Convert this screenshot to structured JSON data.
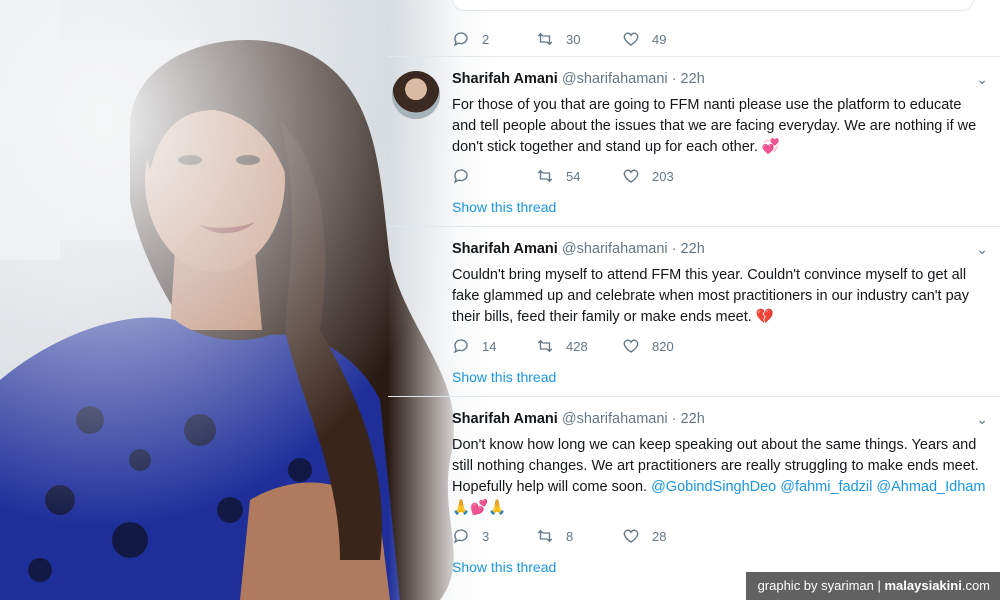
{
  "watermark": {
    "prefix": "graphic by syariman | ",
    "brand": "malaysiakini",
    "suffix": ".com"
  },
  "top_actions": {
    "replies": "2",
    "retweets": "30",
    "likes": "49"
  },
  "tweets": [
    {
      "name": "Sharifah Amani",
      "handle": "@sharifahamani",
      "time": "· 22h",
      "text": "For those of you that are going to FFM nanti please use the platform to educate and tell people about the issues that we are facing everyday. We are nothing if we don't stick together and stand up for each other.",
      "emoji": "💞",
      "replies": "",
      "retweets": "54",
      "likes": "203",
      "show_thread": "Show this thread"
    },
    {
      "name": "Sharifah Amani",
      "handle": "@sharifahamani",
      "time": "· 22h",
      "text": "Couldn't bring myself to attend FFM this year. Couldn't convince myself to get all fake glammed up and celebrate when most practitioners in our industry can't pay their bills, feed their family or make ends meet.",
      "emoji": "💔",
      "replies": "14",
      "retweets": "428",
      "likes": "820",
      "show_thread": "Show this thread"
    },
    {
      "name": "Sharifah Amani",
      "handle": "@sharifahamani",
      "time": "· 22h",
      "text": "Don't know how long we can keep speaking out about the same things. Years and still nothing changes. We art practitioners are really struggling to make ends meet. Hopefully help will come soon.",
      "mentions": "@GobindSinghDeo @fahmi_fadzil @Ahmad_Idham",
      "emoji": "🙏💕🙏",
      "replies": "3",
      "retweets": "8",
      "likes": "28",
      "show_thread": "Show this thread"
    }
  ],
  "colors": {
    "link": "#1b95e0",
    "muted": "#657786",
    "text": "#14171a",
    "dress": "#1f2f9a",
    "hair": "#2a1a14"
  }
}
